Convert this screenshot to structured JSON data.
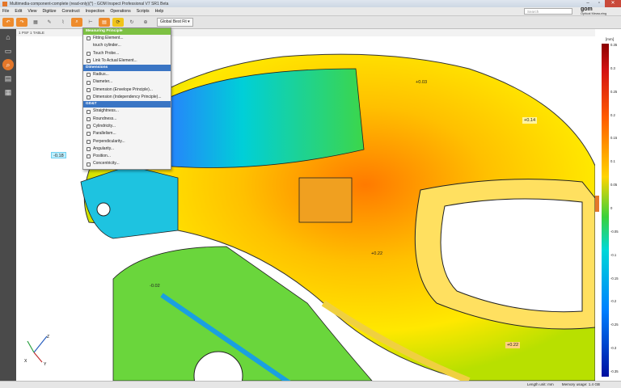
{
  "window": {
    "title": "Multimedia-component-complete (read-only)(*) - GOM Inspect Professional V7 SR1 Beta",
    "controls": [
      "–",
      "▫",
      "✕"
    ]
  },
  "menu": [
    "File",
    "Edit",
    "View",
    "Digitize",
    "Construct",
    "Inspection",
    "Operations",
    "Scripts",
    "Help"
  ],
  "search": {
    "placeholder": "Search"
  },
  "brand": {
    "name": "gom",
    "tagline": "Optical Measuring Techniques"
  },
  "toolbar": {
    "alignment": "Global Best Fit"
  },
  "breadcrumb": "1 PSF    1 TABLE",
  "dropdown": {
    "sections": [
      {
        "header": "Measuring Principle",
        "items": [
          "Fitting Element...",
          "touch cylinder...",
          "Touch Probe...",
          "Link To Actual Element..."
        ]
      },
      {
        "header": "Dimensions",
        "items": [
          "Radius...",
          "Diameter...",
          "Dimension (Envelope Principle)...",
          "Dimension (Independency Principle)..."
        ]
      },
      {
        "header": "GD&T",
        "items": [
          "Straightness...",
          "Roundness...",
          "Cylindricity...",
          "Parallelism...",
          "Perpendicularity...",
          "Angularity...",
          "Position...",
          "Concentricity..."
        ]
      }
    ]
  },
  "labels": [
    {
      "text": "+0.03"
    },
    {
      "text": "+0.14"
    },
    {
      "text": "-0.18"
    },
    {
      "text": "+0.22"
    },
    {
      "text": "-0.02"
    },
    {
      "text": "+0.22"
    }
  ],
  "colorbar": {
    "unit": "[mm]",
    "ticks": [
      "0.35",
      "0.3",
      "0.25",
      "0.2",
      "0.15",
      "0.1",
      "0.05",
      "0",
      "-0.05",
      "-0.1",
      "-0.15",
      "-0.2",
      "-0.25",
      "-0.3",
      "-0.35"
    ],
    "max": 0.35,
    "min": -0.35
  },
  "axis": {
    "labels": [
      "X",
      "Y",
      "Z"
    ]
  },
  "status": {
    "length_unit": "Length unit: mm",
    "memory": "Memory usage: 1.4 GB"
  },
  "colors": {
    "accent": "#ee8b2c",
    "deviation_high": "#d31212",
    "deviation_zero": "#3bd13b",
    "deviation_low": "#0010a0"
  }
}
